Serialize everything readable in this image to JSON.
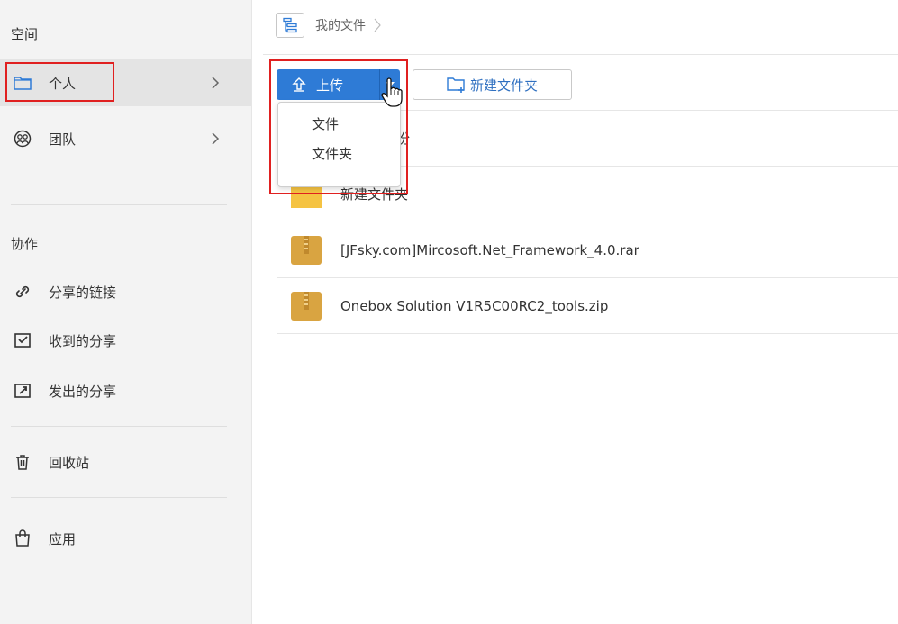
{
  "sidebar": {
    "space_heading": "空间",
    "items": [
      {
        "label": "个人",
        "icon": "folder-icon"
      },
      {
        "label": "团队",
        "icon": "team-icon"
      }
    ],
    "collab_heading": "协作",
    "collab_items": [
      {
        "label": "分享的链接",
        "icon": "link-icon"
      },
      {
        "label": "收到的分享",
        "icon": "inbox-icon"
      },
      {
        "label": "发出的分享",
        "icon": "outbox-icon"
      }
    ],
    "recycle_label": "回收站",
    "apps_label": "应用"
  },
  "breadcrumb": {
    "current": "我的文件"
  },
  "toolbar": {
    "upload_label": "上传",
    "new_folder_label": "新建文件夹"
  },
  "upload_menu": {
    "items": [
      "文件",
      "文件夹"
    ]
  },
  "files": [
    {
      "name": "的备份",
      "type": "folder"
    },
    {
      "name": "新建文件夹",
      "type": "folder"
    },
    {
      "name": "[JFsky.com]Mircosoft.Net_Framework_4.0.rar",
      "type": "archive"
    },
    {
      "name": "Onebox Solution V1R5C00RC2_tools.zip",
      "type": "archive"
    }
  ],
  "colors": {
    "accent": "#2e7bd6",
    "highlight_border": "#e02020",
    "folder": "#f5c342",
    "archive": "#d9a441"
  }
}
